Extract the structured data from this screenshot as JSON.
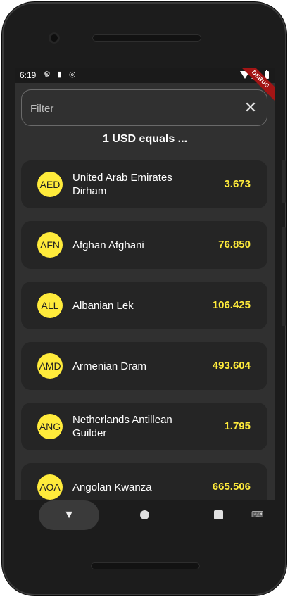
{
  "status_bar": {
    "time": "6:19",
    "icons": [
      "gear-icon",
      "sd-card-icon",
      "sync-icon",
      "wifi-icon",
      "signal-icon",
      "battery-icon"
    ],
    "debug_banner": "DEBUG"
  },
  "filter": {
    "placeholder": "Filter",
    "value": ""
  },
  "heading": "1 USD equals ...",
  "currencies": [
    {
      "code": "AED",
      "name": "United Arab Emirates Dirham",
      "rate": "3.673"
    },
    {
      "code": "AFN",
      "name": "Afghan Afghani",
      "rate": "76.850"
    },
    {
      "code": "ALL",
      "name": "Albanian Lek",
      "rate": "106.425"
    },
    {
      "code": "AMD",
      "name": "Armenian Dram",
      "rate": "493.604"
    },
    {
      "code": "ANG",
      "name": "Netherlands Antillean Guilder",
      "rate": "1.795"
    },
    {
      "code": "AOA",
      "name": "Angolan Kwanza",
      "rate": "665.506"
    }
  ],
  "colors": {
    "accent": "#ffeb3b",
    "card": "#252525",
    "background": "#303030"
  }
}
